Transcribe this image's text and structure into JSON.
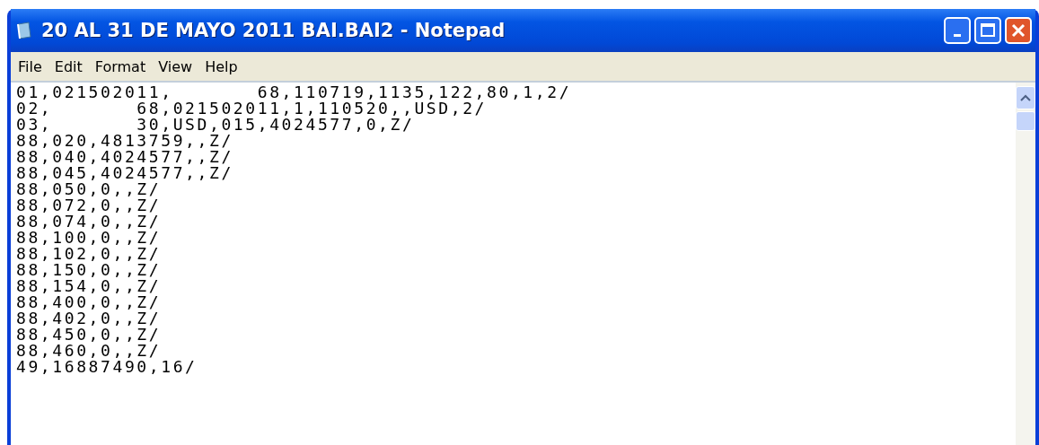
{
  "window": {
    "title": "20 AL 31 DE MAYO 2011 BAI.BAI2 - Notepad"
  },
  "menu": [
    "File",
    "Edit",
    "Format",
    "View",
    "Help"
  ],
  "editor": {
    "lines": [
      "01,021502011,       68,110719,1135,122,80,1,2/",
      "02,       68,021502011,1,110520,,USD,2/",
      "03,       30,USD,015,4024577,0,Z/",
      "88,020,4813759,,Z/",
      "88,040,4024577,,Z/",
      "88,045,4024577,,Z/",
      "88,050,0,,Z/",
      "88,072,0,,Z/",
      "88,074,0,,Z/",
      "88,100,0,,Z/",
      "88,102,0,,Z/",
      "88,150,0,,Z/",
      "88,154,0,,Z/",
      "88,400,0,,Z/",
      "88,402,0,,Z/",
      "88,450,0,,Z/",
      "88,460,0,,Z/",
      "49,16887490,16/"
    ]
  }
}
